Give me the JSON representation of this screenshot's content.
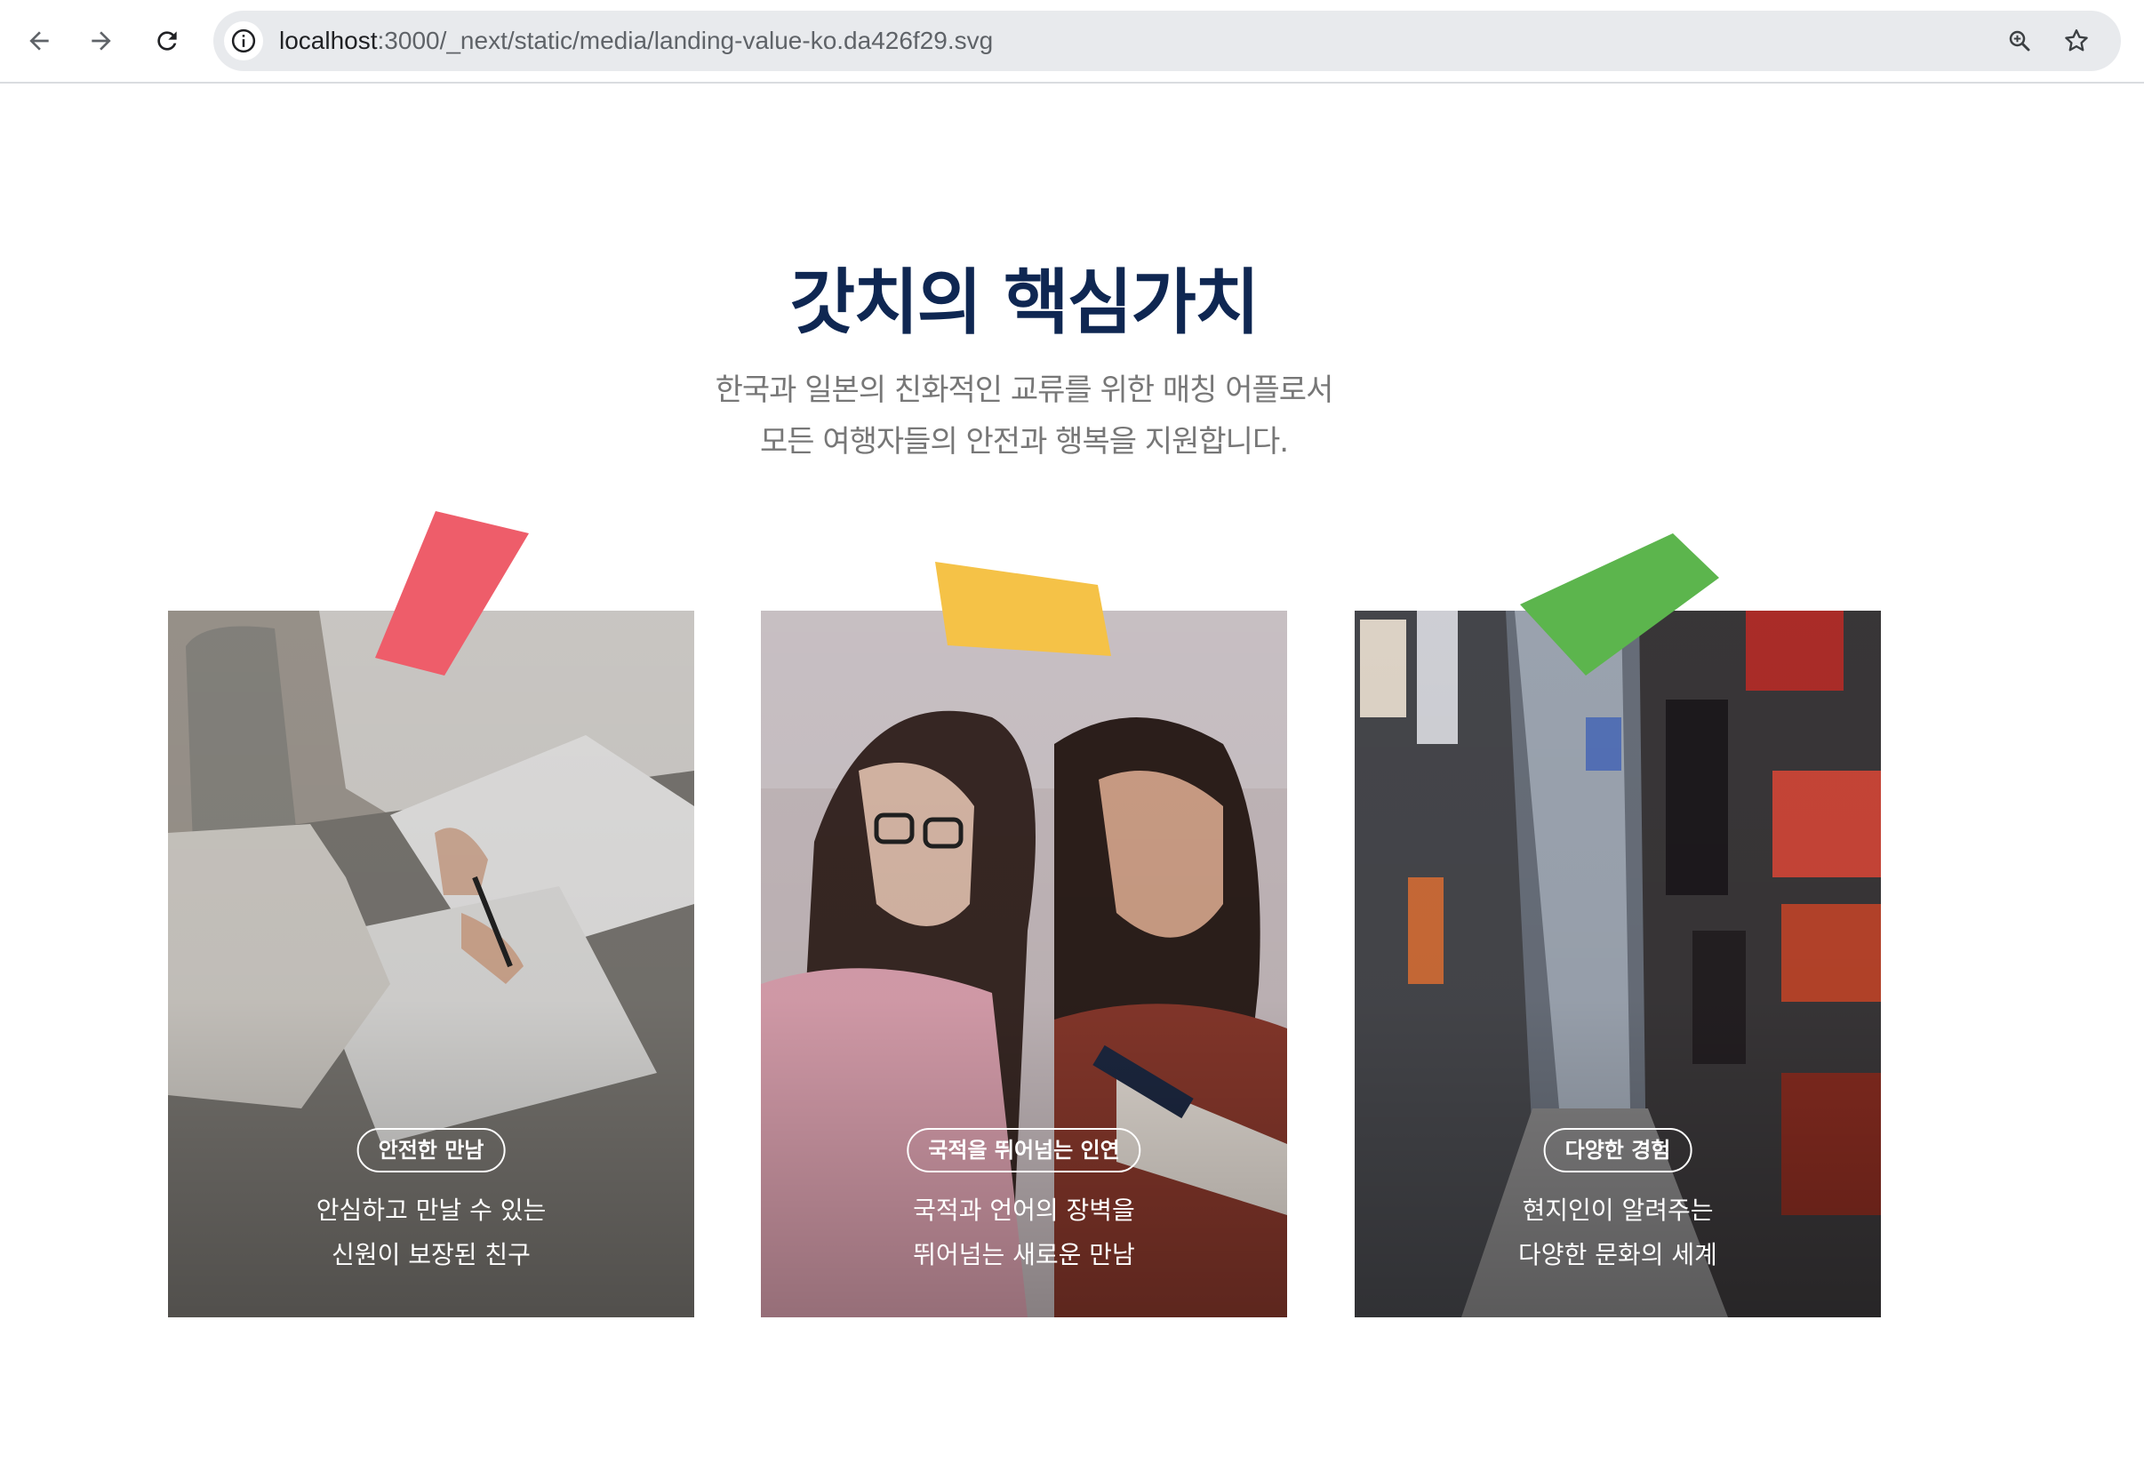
{
  "browser": {
    "url_host": "localhost",
    "url_path": ":3000/_next/static/media/landing-value-ko.da426f29.svg",
    "icons": [
      "back-arrow-icon",
      "forward-arrow-icon",
      "reload-icon",
      "info-icon",
      "zoom-icon",
      "star-icon"
    ]
  },
  "page": {
    "title": "갓치의 핵심가치",
    "subtitle_line1": "한국과 일본의 친화적인 교류를 위한 매칭 어플로서",
    "subtitle_line2": "모든 여행자들의 안전과 행복을 지원합니다."
  },
  "cards": [
    {
      "badge": "안전한 만남",
      "line1": "안심하고 만날 수 있는",
      "line2": "신원이 보장된 친구",
      "tape_color": "#ee5d6a"
    },
    {
      "badge": "국적을 뛰어넘는 인연",
      "line1": "국적과 언어의 장벽을",
      "line2": "뛰어넘는 새로운 만남",
      "tape_color": "#f5c247"
    },
    {
      "badge": "다양한 경험",
      "line1": "현지인이 알려주는",
      "line2": "다양한 문화의 세계",
      "tape_color": "#5cb54d"
    }
  ]
}
